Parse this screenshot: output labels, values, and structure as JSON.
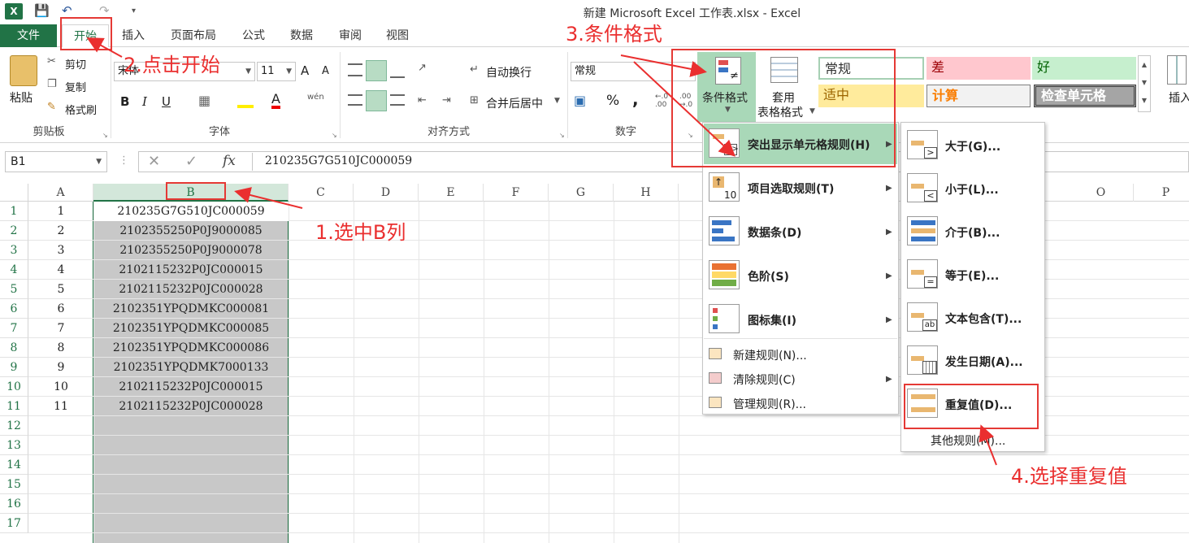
{
  "window": {
    "title": "新建 Microsoft Excel 工作表.xlsx - Excel"
  },
  "tabs": [
    "文件",
    "开始",
    "插入",
    "页面布局",
    "公式",
    "数据",
    "审阅",
    "视图"
  ],
  "ribbon": {
    "clipboard": {
      "paste": "粘贴",
      "cut": "剪切",
      "copy": "复制",
      "format_painter": "格式刷",
      "label": "剪贴板"
    },
    "font": {
      "name": "宋体",
      "size": "11",
      "bold": "B",
      "italic": "I",
      "underline": "U",
      "grow": "A",
      "shrink": "A",
      "font_color": "A",
      "wen": "wén",
      "label": "字体"
    },
    "alignment": {
      "wrap": "自动换行",
      "merge": "合并后居中",
      "label": "对齐方式"
    },
    "number": {
      "format": "常规",
      "percent": "%",
      "comma": ",",
      "label": "数字"
    },
    "conditional_format": "条件格式",
    "table_format_1": "套用",
    "table_format_2": "表格格式",
    "insert": "插入",
    "styles": {
      "normal": "常规",
      "bad": "差",
      "good": "好",
      "neutral": "适中",
      "calc": "计算",
      "check": "检查单元格"
    }
  },
  "formula_bar": {
    "name_box": "B1",
    "cancel": "✕",
    "enter": "✓",
    "fx": "fx",
    "value": "210235G7G510JC000059"
  },
  "columns": [
    "A",
    "B",
    "C",
    "D",
    "E",
    "F",
    "G",
    "H",
    "O",
    "P"
  ],
  "rows": [
    "1",
    "2",
    "3",
    "4",
    "5",
    "6",
    "7",
    "8",
    "9",
    "10",
    "11",
    "12",
    "13",
    "14",
    "15",
    "16",
    "17"
  ],
  "cells_a": [
    "1",
    "2",
    "3",
    "4",
    "5",
    "6",
    "7",
    "8",
    "9",
    "10",
    "11"
  ],
  "cells_b": [
    "210235G7G510JC000059",
    "2102355250P0J9000085",
    "2102355250P0J9000078",
    "2102115232P0JC000015",
    "2102115232P0JC000028",
    "2102351YPQDMKC000081",
    "2102351YPQDMKC000085",
    "2102351YPQDMKC000086",
    "2102351YPQDMK7000133",
    "2102115232P0JC000015",
    "2102115232P0JC000028"
  ],
  "cf_menu": {
    "highlight": "突出显示单元格规则(H)",
    "topbottom": "项目选取规则(T)",
    "databar": "数据条(D)",
    "colorscale": "色阶(S)",
    "iconset": "图标集(I)",
    "new_rule": "新建规则(N)...",
    "clear_rule": "清除规则(C)",
    "manage_rule": "管理规则(R)..."
  },
  "sub_menu": {
    "greater": "大于(G)...",
    "less": "小于(L)...",
    "between": "介于(B)...",
    "equal": "等于(E)...",
    "text_contains": "文本包含(T)...",
    "date": "发生日期(A)...",
    "duplicate": "重复值(D)...",
    "more": "其他规则(M)..."
  },
  "annotations": {
    "step1": "1.选中B列",
    "step2": "2.点击开始",
    "step3": "3.条件格式",
    "step4": "4.选择重复值"
  },
  "colors": {
    "excel_green": "#217346",
    "annotation_red": "#ea2f2f",
    "selection_gray": "#c8c8c8",
    "menu_highlight": "#a9d8b8"
  }
}
